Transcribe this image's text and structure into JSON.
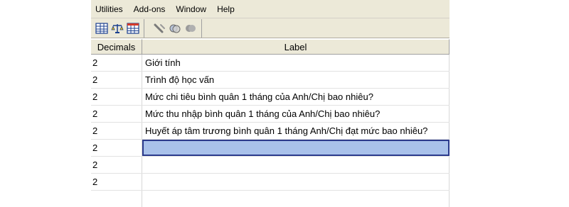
{
  "menubar": {
    "items": [
      "Utilities",
      "Add-ons",
      "Window",
      "Help"
    ]
  },
  "toolbar": {
    "icons": [
      "variables-icon",
      "weight-cases-icon",
      "value-labels-icon",
      "use-sets-icon",
      "show-all-icon",
      "spelling-icon"
    ]
  },
  "grid": {
    "headers": {
      "decimals": "Decimals",
      "label": "Label"
    },
    "rows": [
      {
        "decimals": "2",
        "label": "Giới tính"
      },
      {
        "decimals": "2",
        "label": "Trình độ học vấn"
      },
      {
        "decimals": "2",
        "label": "Mức chi tiêu bình quân 1 tháng của Anh/Chị bao nhiêu?"
      },
      {
        "decimals": "2",
        "label": "Mức thu nhập bình quân 1 tháng của Anh/Chị bao nhiêu?"
      },
      {
        "decimals": "2",
        "label": "Huyết áp tâm trương bình quân 1 tháng Anh/Chị đạt mức bao nhiêu?"
      },
      {
        "decimals": "2",
        "label": ""
      },
      {
        "decimals": "2",
        "label": ""
      },
      {
        "decimals": "2",
        "label": ""
      },
      {
        "decimals": "",
        "label": ""
      }
    ],
    "selected_row": 5
  },
  "colors": {
    "chrome": "#ece9d8",
    "selection_fill": "#a9c1ea",
    "selection_border": "#2b3a8c"
  }
}
